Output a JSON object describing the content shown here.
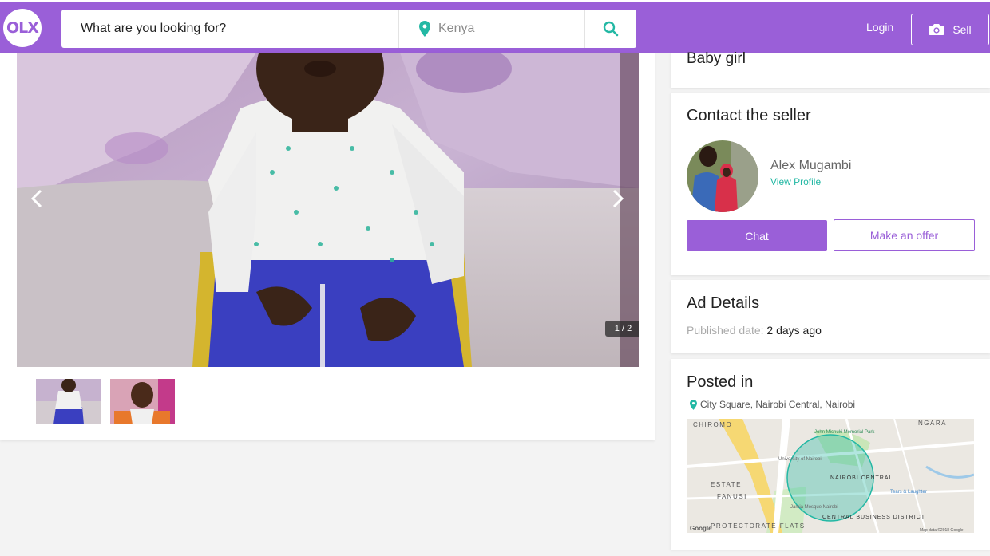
{
  "header": {
    "logo_text": "OLX",
    "search_placeholder": "What are you looking for?",
    "location_placeholder": "Kenya",
    "login_label": "Login",
    "sell_label": "Sell",
    "brand_color": "#9a5fd8",
    "accent_color": "#23b8a4"
  },
  "gallery": {
    "counter": "1 / 2",
    "current_index": 1,
    "total": 2
  },
  "ad": {
    "title": "Baby girl"
  },
  "contact": {
    "heading": "Contact the seller",
    "seller_name": "Alex Mugambi",
    "view_profile": "View Profile",
    "chat_label": "Chat",
    "offer_label": "Make an offer"
  },
  "details": {
    "heading": "Ad Details",
    "published_label": "Published date:",
    "published_value": "2 days ago"
  },
  "posted": {
    "heading": "Posted in",
    "location": "City Square, Nairobi Central, Nairobi",
    "map_labels": {
      "chiromo": "CHIROMO",
      "ngara": "NGARA",
      "estate": "ESTATE",
      "fanusi": "FANUSI",
      "nairobi_central": "NAIROBI CENTRAL",
      "cbd": "CENTRAL BUSINESS DISTRICT",
      "protectorate": "PROTECTORATE FLATS",
      "jevanjee": "Jeevanjee Gardens",
      "uon": "University of Nairobi",
      "jamia": "Jamia Mosque Nairobi",
      "tears": "Tears & Laughter",
      "john_michuki": "John Michuki Memorial Park",
      "google": "Google",
      "map_data": "Map data ©2018 Google"
    }
  }
}
